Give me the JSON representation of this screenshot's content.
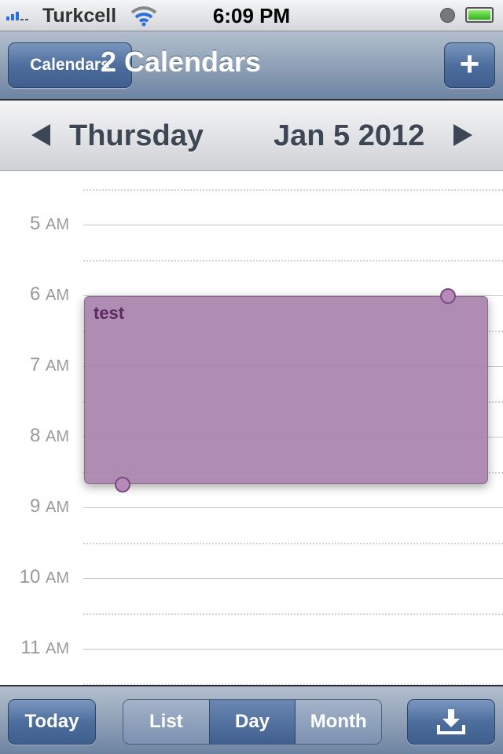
{
  "status_bar": {
    "carrier": "Turkcell",
    "time": "6:09 PM",
    "icons": [
      "signal-icon",
      "wifi-icon",
      "clock-icon",
      "battery-icon"
    ],
    "battery_level": 1.0
  },
  "nav": {
    "calendars_button": "Calendars",
    "title": "2 Calendars",
    "add_button": "+"
  },
  "date_bar": {
    "day": "Thursday",
    "date": "Jan 5 2012"
  },
  "hours": [
    {
      "num": "5",
      "ampm": "AM"
    },
    {
      "num": "6",
      "ampm": "AM"
    },
    {
      "num": "7",
      "ampm": "AM"
    },
    {
      "num": "8",
      "ampm": "AM"
    },
    {
      "num": "9",
      "ampm": "AM"
    },
    {
      "num": "10",
      "ampm": "AM"
    },
    {
      "num": "11",
      "ampm": "AM"
    }
  ],
  "event": {
    "title": "test",
    "color": "#a882aa"
  },
  "toolbar": {
    "today": "Today",
    "segments": [
      "List",
      "Day",
      "Month"
    ],
    "selected": "Day"
  }
}
